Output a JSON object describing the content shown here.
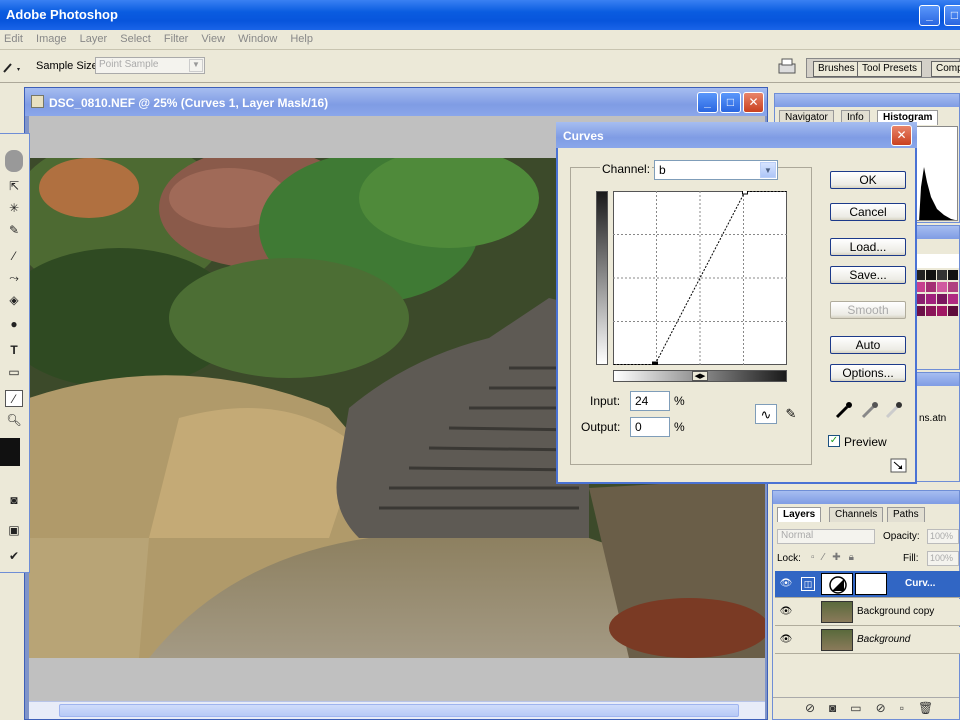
{
  "app": {
    "title": "Adobe Photoshop",
    "controls": [
      "_",
      "□",
      "✕"
    ]
  },
  "menu": {
    "items": [
      "Edit",
      "Image",
      "Layer",
      "Select",
      "Filter",
      "View",
      "Window",
      "Help"
    ]
  },
  "options_bar": {
    "sample_size_label": "Sample Size:",
    "sample_size_value": "Point Sample",
    "palette_tabs": [
      "Brushes",
      "Tool Presets",
      "Comp"
    ]
  },
  "document": {
    "title": "DSC_0810.NEF @ 25% (Curves 1, Layer Mask/16)",
    "controls": [
      "_",
      "□",
      "✕"
    ]
  },
  "navigator_panel": {
    "tabs": [
      "Navigator",
      "Info",
      "Histogram"
    ],
    "active_tab": "Histogram"
  },
  "actions_panel": {
    "item": "ns.atn"
  },
  "layers_panel": {
    "tabs": [
      "Layers",
      "Channels",
      "Paths"
    ],
    "blend_mode": "Normal",
    "opacity_label": "Opacity:",
    "opacity_value": "100%",
    "lock_label": "Lock:",
    "fill_label": "Fill:",
    "fill_value": "100%",
    "layers": [
      {
        "name": "Curv...",
        "selected": true
      },
      {
        "name": "Background copy",
        "selected": false
      },
      {
        "name": "Background",
        "selected": false
      }
    ]
  },
  "curves_dialog": {
    "title": "Curves",
    "channel_label": "Channel:",
    "channel_value": "b",
    "input_label": "Input:",
    "input_value": "24",
    "output_label": "Output:",
    "output_value": "0",
    "percent": "%",
    "buttons": {
      "ok": "OK",
      "cancel": "Cancel",
      "load": "Load...",
      "save": "Save...",
      "smooth": "Smooth",
      "auto": "Auto",
      "options": "Options..."
    },
    "preview_label": "Preview",
    "preview_checked": true,
    "curve_points": [
      {
        "input": 0,
        "output": 0
      },
      {
        "input": 24,
        "output": 0
      },
      {
        "input": 76,
        "output": 100
      },
      {
        "input": 100,
        "output": 100
      }
    ]
  },
  "colors": {
    "xp_blue": "#0a5ce0",
    "selected_layer": "#3166c4"
  }
}
